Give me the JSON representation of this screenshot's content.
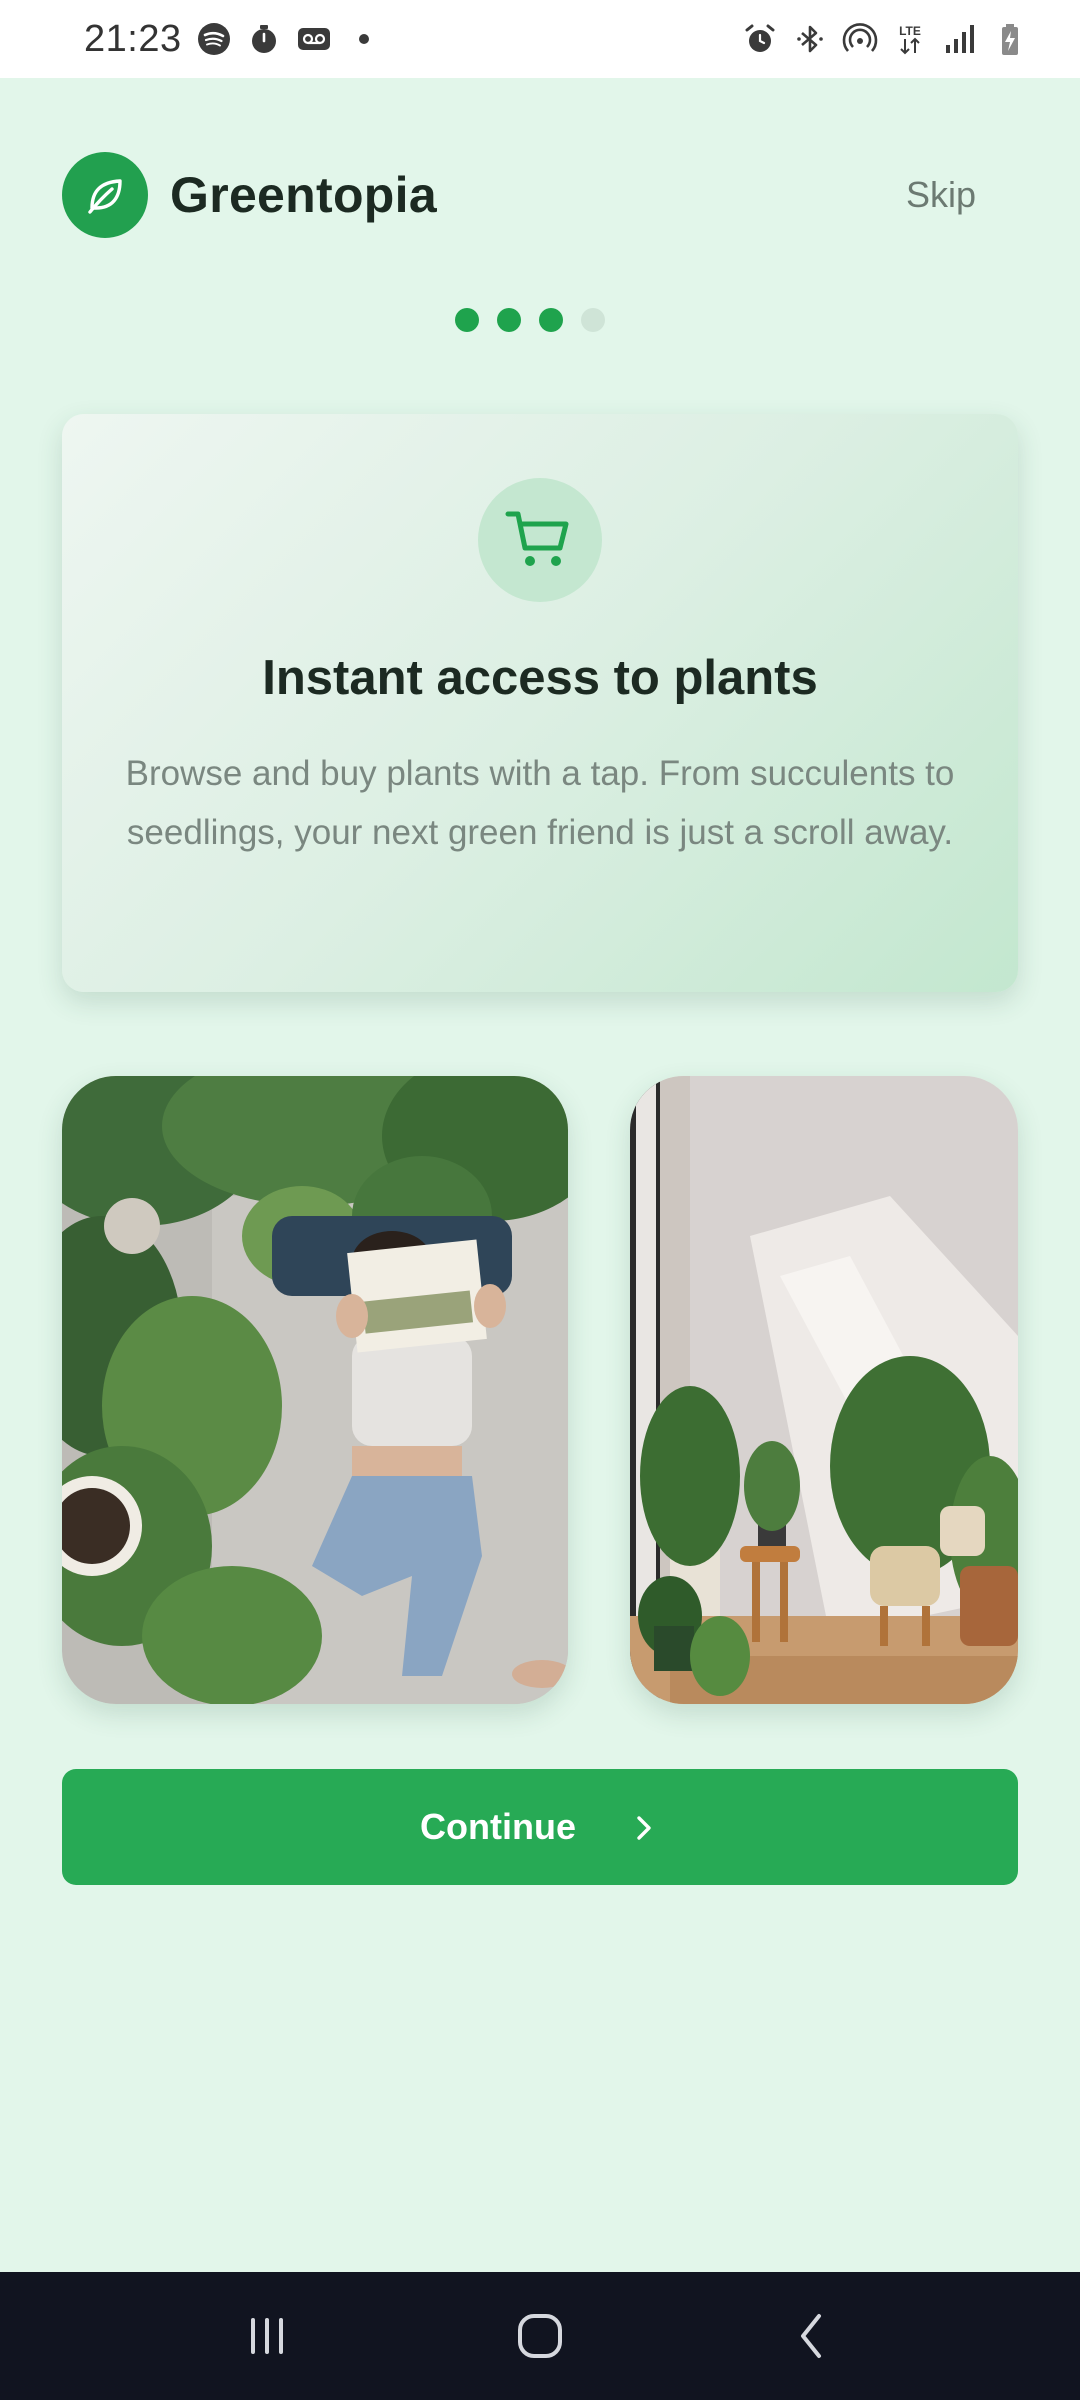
{
  "status_bar": {
    "time": "21:23",
    "left_icons": [
      "spotify-icon",
      "timer-icon",
      "voicemail-icon",
      "dot-icon"
    ],
    "right_icons": [
      "alarm-icon",
      "bluetooth-icon",
      "hotspot-icon",
      "lte-icon",
      "signal-icon",
      "battery-charging-icon"
    ]
  },
  "header": {
    "app_name": "Greentopia",
    "skip_label": "Skip",
    "logo_icon": "leaf-icon"
  },
  "pager": {
    "total": 4,
    "active": 3
  },
  "feature": {
    "icon": "shopping-cart-icon",
    "title": "Instant access to plants",
    "description": "Browse and buy plants with a tap. From succulents to seedlings, your next green friend is just a scroll away."
  },
  "photos": [
    {
      "name": "photo-woman-reading-among-plants"
    },
    {
      "name": "photo-sunlit-room-with-plants"
    }
  ],
  "continue": {
    "label": "Continue",
    "icon": "chevron-right-icon"
  },
  "nav_bar": {
    "buttons": [
      "recent-apps-icon",
      "home-icon",
      "back-icon"
    ]
  },
  "colors": {
    "accent": "#27aa55",
    "background": "#e2f6ea",
    "title_text": "#1c2a22",
    "muted_text": "#7a8780"
  }
}
